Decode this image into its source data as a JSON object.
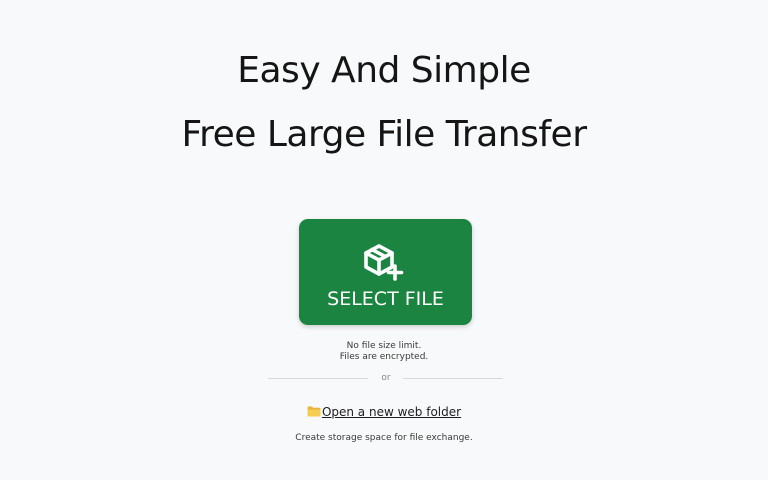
{
  "hero": {
    "headline_line1": "Easy And Simple",
    "headline_line2": "Free Large File Transfer"
  },
  "upload": {
    "button_label": "SELECT FILE",
    "icon": "package-plus-icon",
    "button_color": "#1b8441",
    "note_line1": "No file size limit.",
    "note_line2": "Files are encrypted."
  },
  "separator": {
    "text": "or"
  },
  "web_folder": {
    "icon": "folder-icon",
    "link_text": "Open a new web folder",
    "description": "Create storage space for file exchange."
  }
}
